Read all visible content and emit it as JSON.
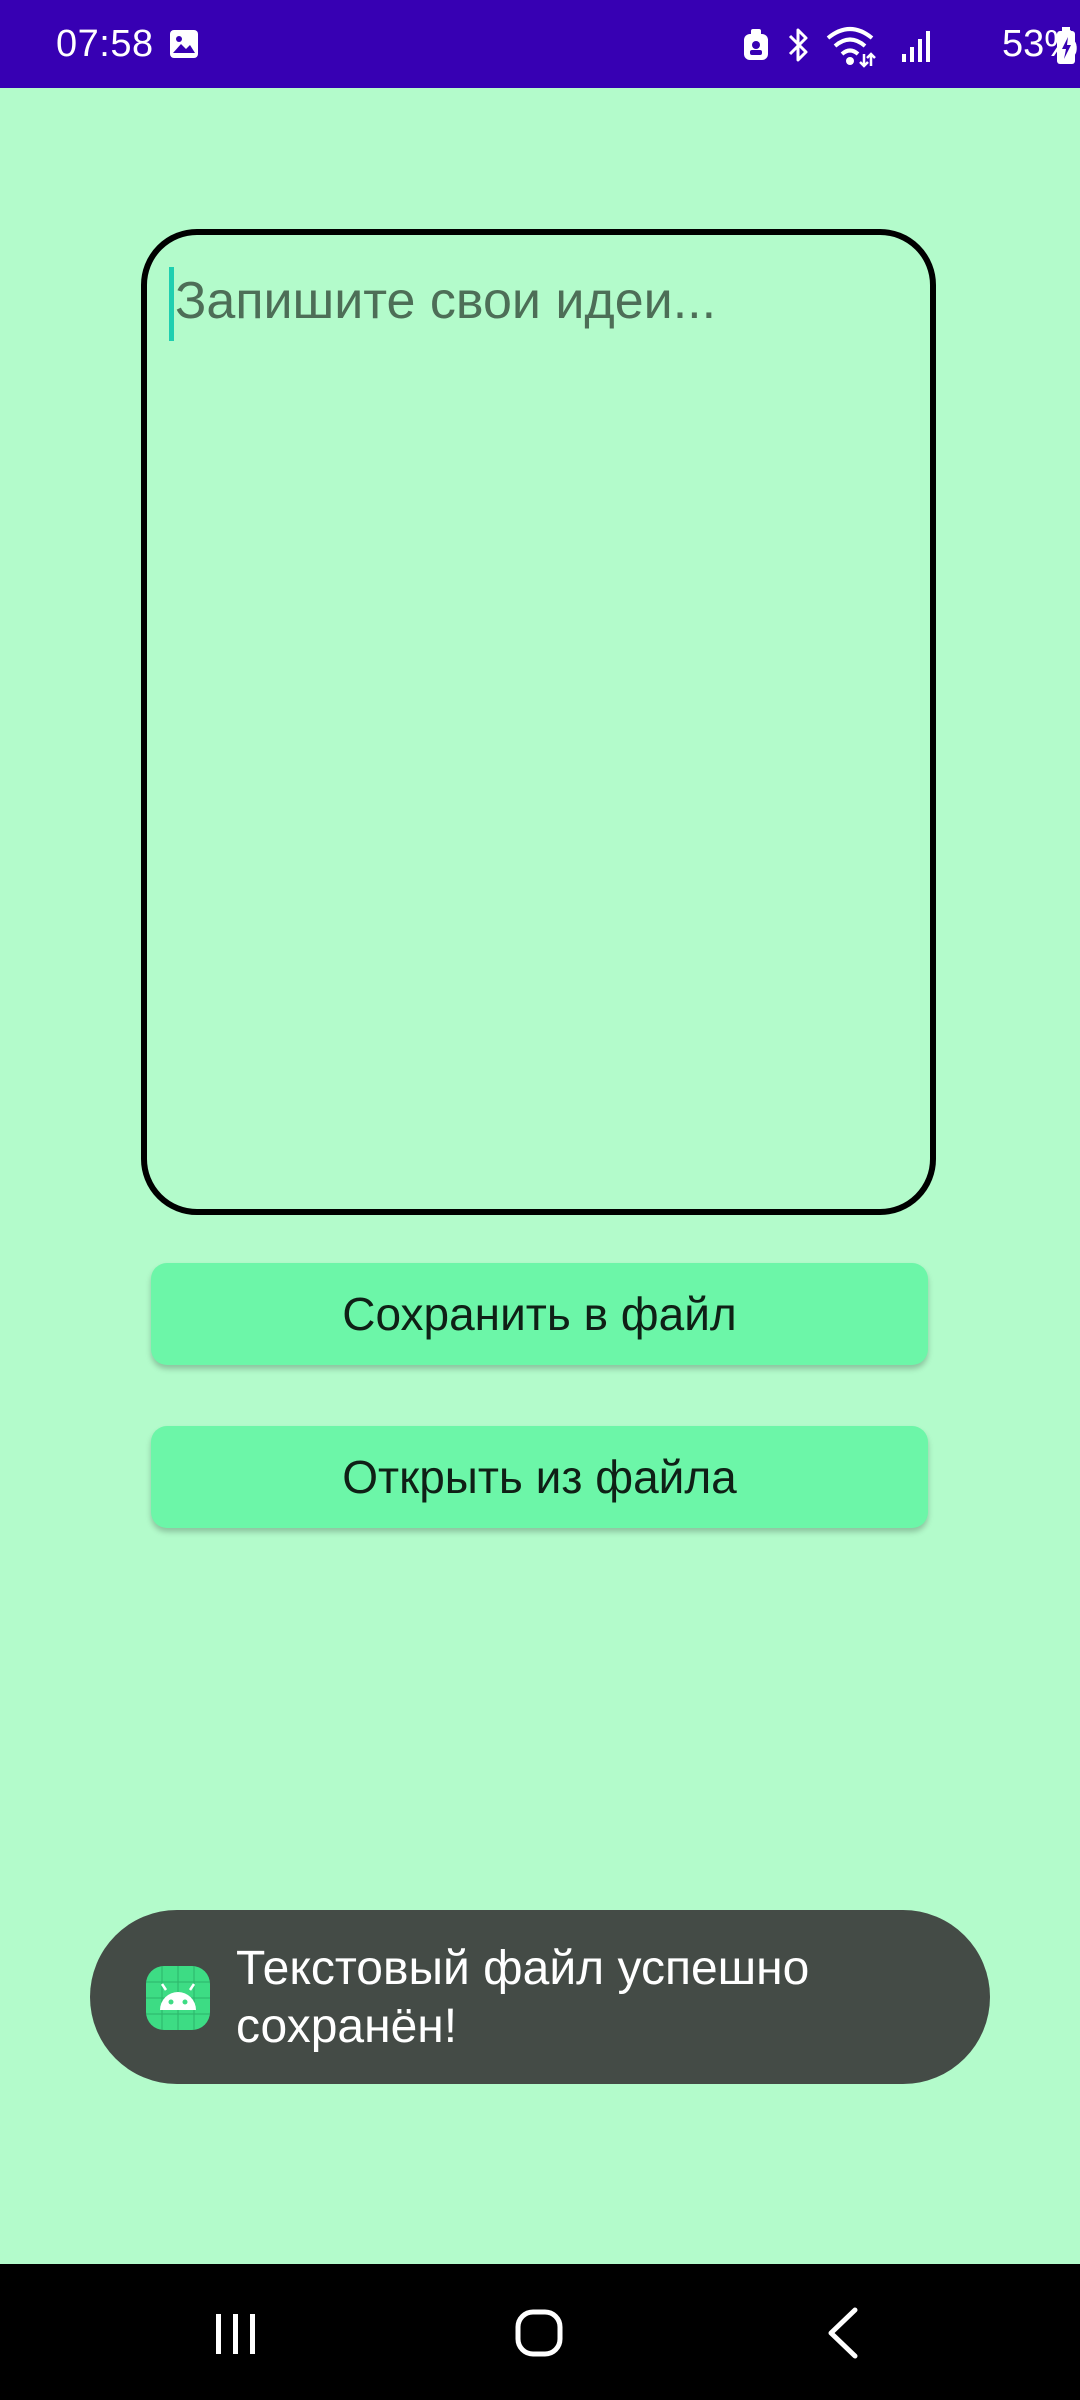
{
  "status_bar": {
    "time": "07:58",
    "battery_percent": "53%",
    "icons": [
      "gallery-icon",
      "device-icon",
      "bluetooth-icon",
      "wifi-icon",
      "signal-icon",
      "battery-charging-icon"
    ],
    "background_color": "#3700b3"
  },
  "editor": {
    "placeholder": "Запишите свои идеи...",
    "value": ""
  },
  "buttons": {
    "save_label": "Сохранить в файл",
    "open_label": "Открыть из файла",
    "color": "#6cf6a8"
  },
  "toast": {
    "message": "Текстовый файл успешно сохранён!",
    "icon": "android-app-icon"
  },
  "nav_bar": {
    "icons": [
      "recents-icon",
      "home-icon",
      "back-icon"
    ]
  },
  "theme": {
    "background": "#b3fbcb"
  }
}
